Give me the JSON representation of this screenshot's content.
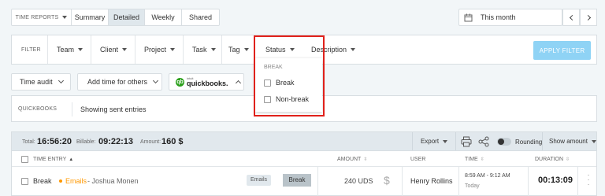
{
  "toolbar": {
    "reports_label": "TIME REPORTS",
    "tabs": [
      "Summary",
      "Detailed",
      "Weekly",
      "Shared"
    ],
    "active_tab": "Detailed",
    "date_range": "This month"
  },
  "filter": {
    "label": "FILTER",
    "items": [
      "Team",
      "Client",
      "Project",
      "Task",
      "Tag",
      "Status",
      "Description"
    ],
    "apply_label": "APPLY FILTER",
    "status_dropdown": {
      "section": "BREAK",
      "options": [
        "Break",
        "Non-break"
      ]
    }
  },
  "actions": {
    "time_audit": "Time audit",
    "add_time": "Add time for others",
    "quickbooks_prefix": "intuit",
    "quickbooks": "quickbooks."
  },
  "quickbooks_bar": {
    "label": "QUICKBOOKS",
    "status": "Showing sent entries"
  },
  "summary": {
    "total_label": "Total:",
    "total": "16:56:20",
    "billable_label": "Billable:",
    "billable": "09:22:13",
    "amount_label": "Amount:",
    "amount": "160 $",
    "export": "Export",
    "rounding": "Rounding",
    "show_amount": "Show amount"
  },
  "table": {
    "headers": {
      "time_entry": "TIME ENTRY",
      "amount": "AMOUNT",
      "user": "USER",
      "time": "TIME",
      "duration": "DURATION"
    },
    "rows": [
      {
        "description": "Break",
        "project": "Emails",
        "client": "- Joshua Monen",
        "tag": "Emails",
        "status": "Break",
        "amount": "240 UDS",
        "user": "Henry Rollins",
        "time_range": "8:59 AM - 9:12 AM",
        "day": "Today",
        "duration": "00:13:09"
      }
    ]
  },
  "colors": {
    "accent": "#03a9f4",
    "apply_button": "#8fd3f5",
    "highlight": "#e0211b",
    "project_dot": "#ff9800"
  }
}
